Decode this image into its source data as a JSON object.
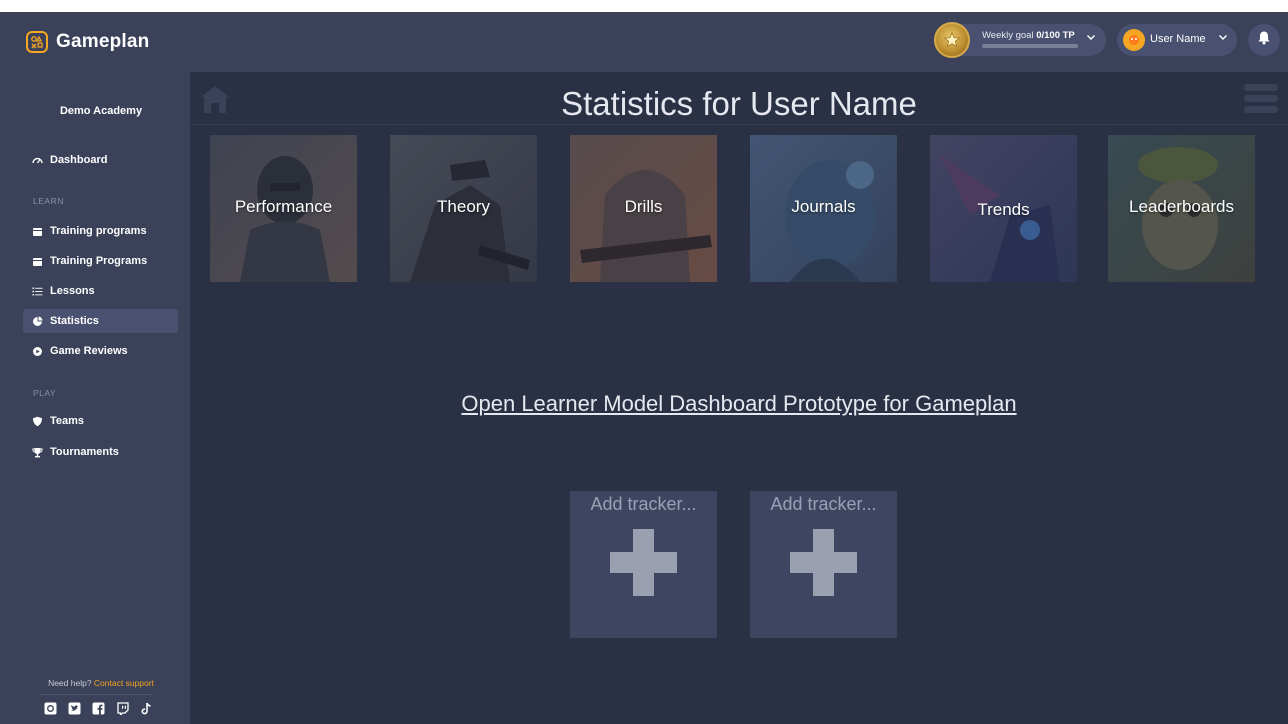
{
  "brand": {
    "name": "Gameplan",
    "accent": "#f5a623"
  },
  "header": {
    "weekly_goal": {
      "label": "Weekly goal",
      "value": "0/100 TP",
      "progress": 0
    },
    "user": {
      "name": "User Name"
    }
  },
  "sidebar": {
    "academy": "Demo Academy",
    "dashboard": {
      "label": "Dashboard",
      "icon": "dashboard-icon"
    },
    "learn_heading": "LEARN",
    "learn_items": [
      {
        "label": "Training programs",
        "icon": "training-programs-icon"
      },
      {
        "label": "Training Programs",
        "icon": "training-programs-icon"
      },
      {
        "label": "Lessons",
        "icon": "lessons-icon"
      },
      {
        "label": "Statistics",
        "icon": "statistics-icon",
        "active": true
      },
      {
        "label": "Game Reviews",
        "icon": "game-reviews-icon"
      }
    ],
    "play_heading": "PLAY",
    "play_items": [
      {
        "label": "Teams",
        "icon": "teams-icon"
      },
      {
        "label": "Tournaments",
        "icon": "tournaments-icon"
      }
    ],
    "help_text": "Need help?",
    "help_link": "Contact support",
    "socials": [
      "instagram-icon",
      "twitter-icon",
      "facebook-icon",
      "twitch-icon",
      "tiktok-icon"
    ]
  },
  "main": {
    "title": "Statistics for User Name",
    "tiles": [
      {
        "label": "Performance"
      },
      {
        "label": "Theory"
      },
      {
        "label": "Drills"
      },
      {
        "label": "Journals"
      },
      {
        "label": "Trends"
      },
      {
        "label": "Leaderboards"
      }
    ],
    "olm_link": "Open Learner Model Dashboard Prototype for Gameplan",
    "trackers": [
      {
        "label": "Add tracker..."
      },
      {
        "label": "Add tracker..."
      }
    ]
  }
}
